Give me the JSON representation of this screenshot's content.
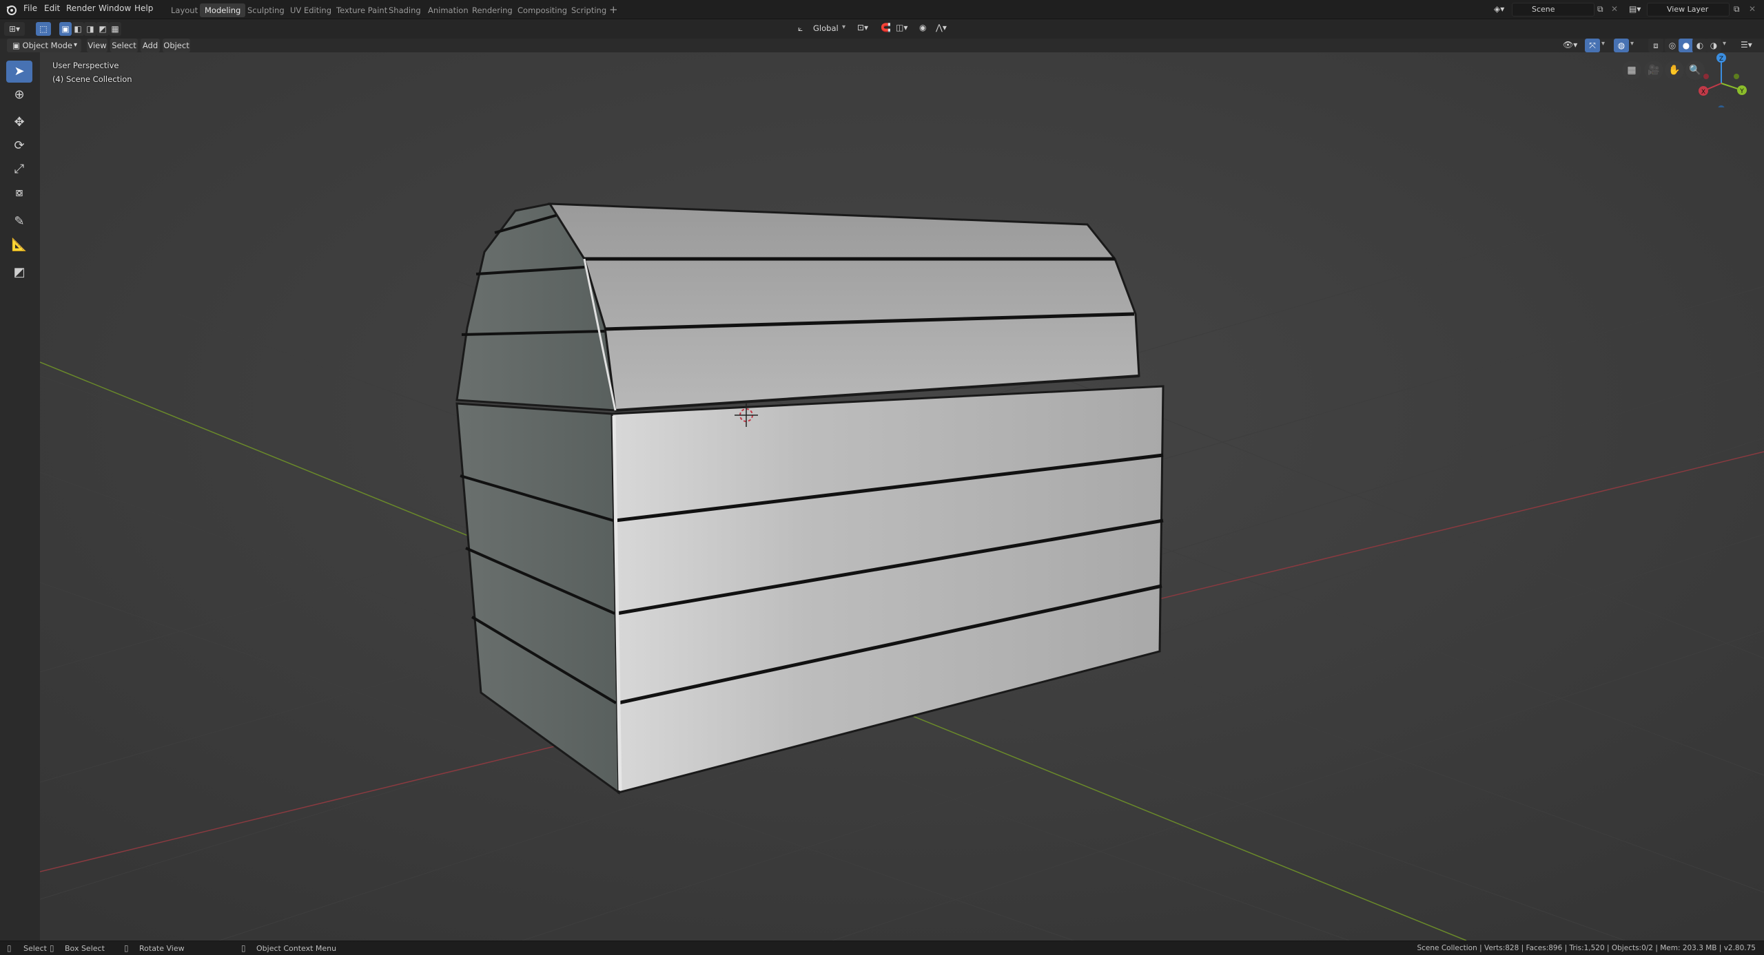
{
  "menu": [
    "File",
    "Edit",
    "Render",
    "Window",
    "Help"
  ],
  "workspaces": [
    "Layout",
    "Modeling",
    "Sculpting",
    "UV Editing",
    "Texture Paint",
    "Shading",
    "Animation",
    "Rendering",
    "Compositing",
    "Scripting"
  ],
  "active_workspace": "Modeling",
  "scene_field": "Scene",
  "view_layer_field": "View Layer",
  "transform_orientation": "Global",
  "mode": "Object Mode",
  "viewport_menu": [
    "View",
    "Select",
    "Add",
    "Object"
  ],
  "overlay": {
    "perspective": "User Perspective",
    "collection": "(4) Scene Collection"
  },
  "gizmo": {
    "x": "X",
    "y": "Y",
    "z": "Z"
  },
  "status": {
    "select": "Select",
    "box_select": "Box Select",
    "rotate_view": "Rotate View",
    "context_menu": "Object Context Menu",
    "stats": "Scene Collection | Verts:828 | Faces:896 | Tris:1,520 | Objects:0/2 | Mem: 203.3 MB | v2.80.75"
  },
  "icons": {
    "blender_logo": "blender-logo-icon",
    "editor_type": "editor-type-icon",
    "select_mode": "select-box-icon",
    "cursor": "cursor-icon",
    "move": "move-icon",
    "rotate": "rotate-icon",
    "scale": "scale-icon",
    "transform": "transform-icon",
    "annotate": "annotate-icon",
    "measure": "measure-icon",
    "add_cube": "add-cube-icon"
  },
  "colors": {
    "accent": "#4772b3",
    "axis_x": "#c33a48",
    "axis_y": "#8bbd2b",
    "axis_z": "#3b8ee0"
  }
}
